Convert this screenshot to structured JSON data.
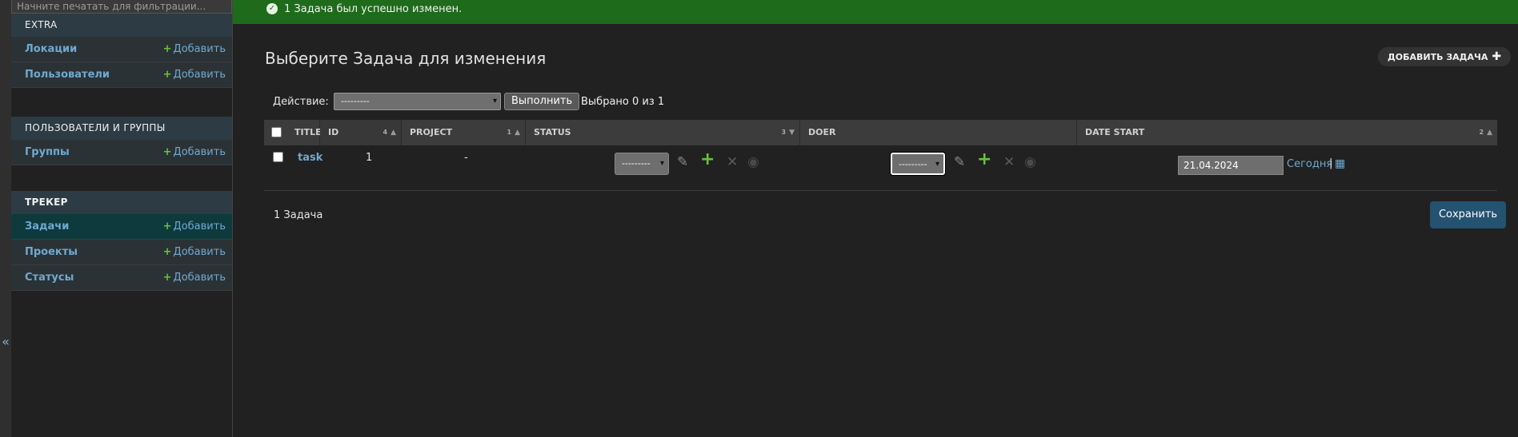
{
  "sidebar": {
    "filter_placeholder": "Начните печатать для фильтрации...",
    "modules": [
      {
        "caption": "EXTRA",
        "items": [
          {
            "label": "Локации",
            "add": "Добавить"
          },
          {
            "label": "Пользователи",
            "add": "Добавить"
          }
        ]
      },
      {
        "caption": "ПОЛЬЗОВАТЕЛИ И ГРУППЫ",
        "items": [
          {
            "label": "Группы",
            "add": "Добавить"
          }
        ]
      },
      {
        "caption": "ТРЕКЕР",
        "items": [
          {
            "label": "Задачи",
            "add": "Добавить",
            "current": true
          },
          {
            "label": "Проекты",
            "add": "Добавить"
          },
          {
            "label": "Статусы",
            "add": "Добавить"
          }
        ]
      }
    ],
    "collapse_label": "«"
  },
  "message": "1 Задача был успешно изменен.",
  "page_title": "Выберите Задача для изменения",
  "add_button": "ДОБАВИТЬ ЗАДАЧА",
  "actions": {
    "label": "Действие:",
    "select_value": "---------",
    "go": "Выполнить",
    "selected": "Выбрано 0 из 1"
  },
  "table": {
    "columns": [
      {
        "label": "TITLE",
        "sort": ""
      },
      {
        "label": "ID",
        "sort": "4"
      },
      {
        "label": "PROJECT",
        "sort": "1"
      },
      {
        "label": "STATUS",
        "sort": "3"
      },
      {
        "label": "DOER",
        "sort": ""
      },
      {
        "label": "DATE START",
        "sort": "2"
      }
    ],
    "rows": [
      {
        "title": "task",
        "id": "1",
        "project": "-",
        "status": "---------",
        "doer": "---------",
        "date_start": "21.04.2024",
        "today": "Сегодня",
        "sep": "|"
      }
    ]
  },
  "result_count": "1 Задача",
  "save_button": "Сохранить",
  "colors": {
    "success": "#1e6b1b",
    "link": "#6fa9cf",
    "add": "#68c040",
    "save": "#245271"
  }
}
